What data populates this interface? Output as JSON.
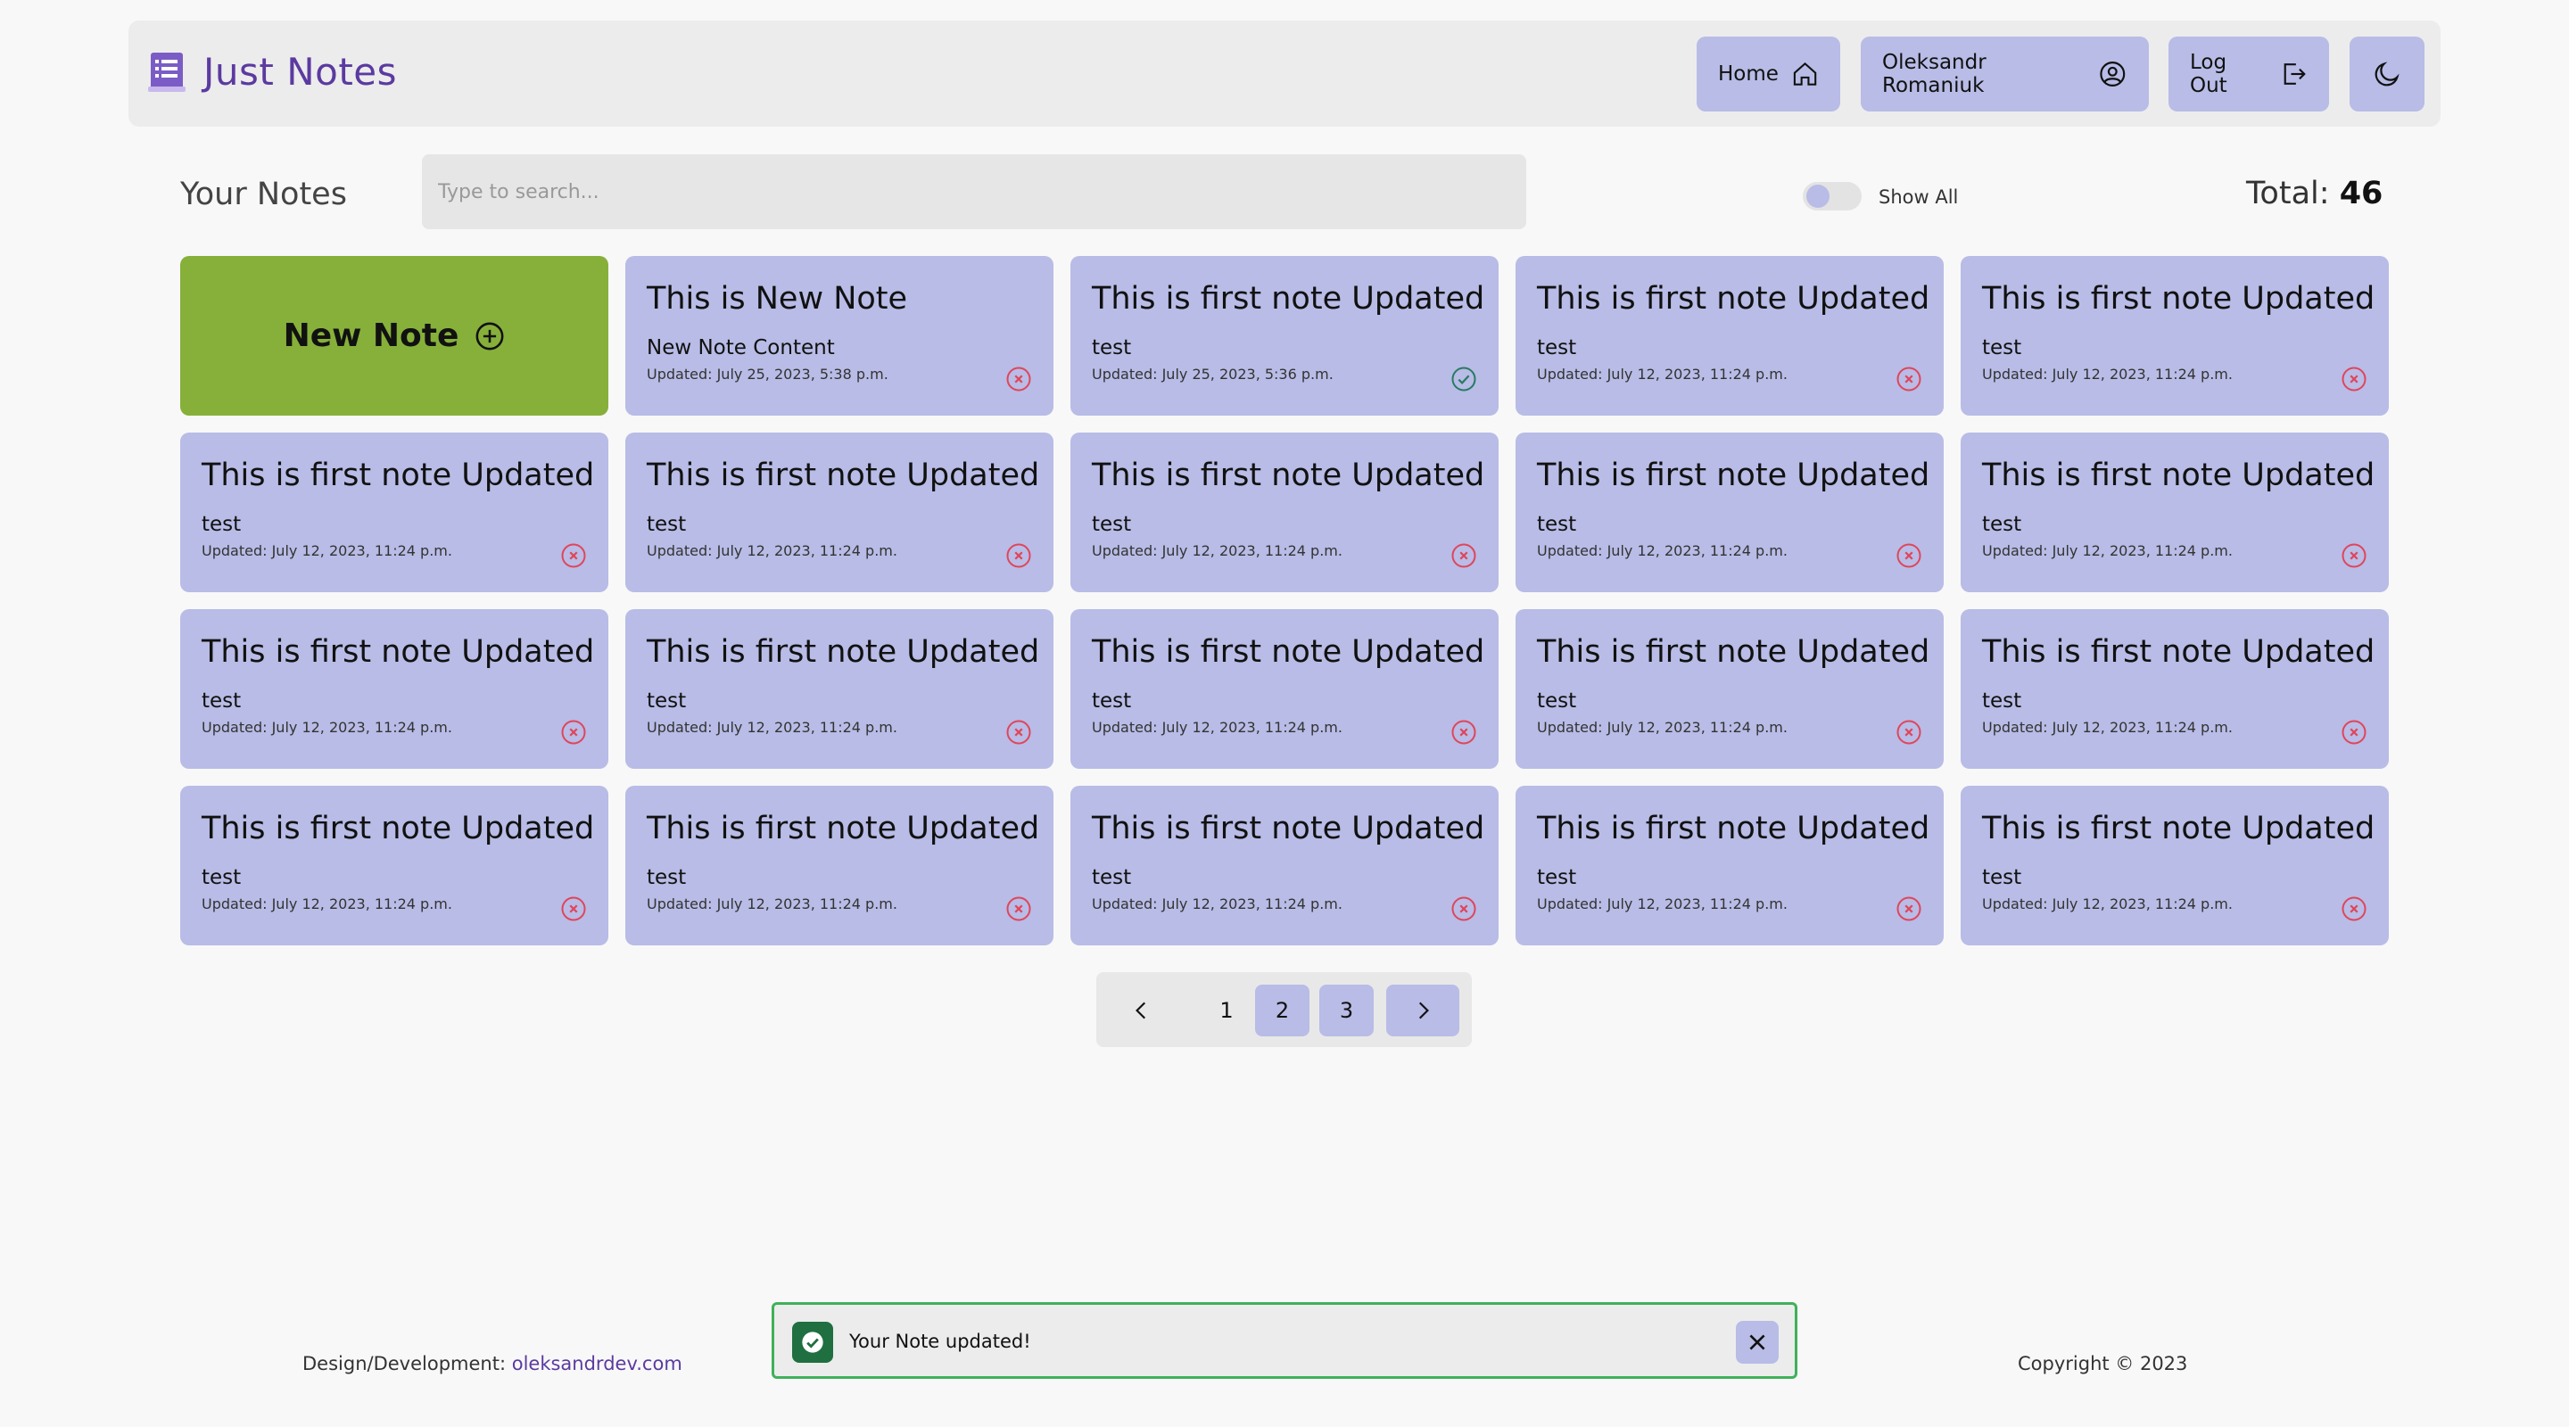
{
  "app": {
    "title": "Just Notes"
  },
  "nav": {
    "home_label": "Home",
    "user_label": "Oleksandr Romaniuk",
    "logout_label": "Log Out",
    "icons": [
      "notebook-icon",
      "home-icon",
      "user-circle-icon",
      "logout-icon",
      "moon-icon"
    ]
  },
  "toolbar": {
    "heading": "Your Notes",
    "search_placeholder": "Type to search...",
    "show_all_label": "Show All",
    "show_all_on": false,
    "total_label": "Total:",
    "total_value": "46"
  },
  "new_note": {
    "label": "New Note"
  },
  "notes": [
    {
      "title": "This is New Note",
      "content": "New Note Content",
      "date": "Updated: July 25, 2023, 5:38 p.m.",
      "done": false
    },
    {
      "title": "This is first note Updated",
      "content": "test",
      "date": "Updated: July 25, 2023, 5:36 p.m.",
      "done": true
    },
    {
      "title": "This is first note Updated",
      "content": "test",
      "date": "Updated: July 12, 2023, 11:24 p.m.",
      "done": false
    },
    {
      "title": "This is first note Updated",
      "content": "test",
      "date": "Updated: July 12, 2023, 11:24 p.m.",
      "done": false
    },
    {
      "title": "This is first note Updated",
      "content": "test",
      "date": "Updated: July 12, 2023, 11:24 p.m.",
      "done": false
    },
    {
      "title": "This is first note Updated",
      "content": "test",
      "date": "Updated: July 12, 2023, 11:24 p.m.",
      "done": false
    },
    {
      "title": "This is first note Updated",
      "content": "test",
      "date": "Updated: July 12, 2023, 11:24 p.m.",
      "done": false
    },
    {
      "title": "This is first note Updated",
      "content": "test",
      "date": "Updated: July 12, 2023, 11:24 p.m.",
      "done": false
    },
    {
      "title": "This is first note Updated",
      "content": "test",
      "date": "Updated: July 12, 2023, 11:24 p.m.",
      "done": false
    },
    {
      "title": "This is first note Updated",
      "content": "test",
      "date": "Updated: July 12, 2023, 11:24 p.m.",
      "done": false
    },
    {
      "title": "This is first note Updated",
      "content": "test",
      "date": "Updated: July 12, 2023, 11:24 p.m.",
      "done": false
    },
    {
      "title": "This is first note Updated",
      "content": "test",
      "date": "Updated: July 12, 2023, 11:24 p.m.",
      "done": false
    },
    {
      "title": "This is first note Updated",
      "content": "test",
      "date": "Updated: July 12, 2023, 11:24 p.m.",
      "done": false
    },
    {
      "title": "This is first note Updated",
      "content": "test",
      "date": "Updated: July 12, 2023, 11:24 p.m.",
      "done": false
    },
    {
      "title": "This is first note Updated",
      "content": "test",
      "date": "Updated: July 12, 2023, 11:24 p.m.",
      "done": false
    },
    {
      "title": "This is first note Updated",
      "content": "test",
      "date": "Updated: July 12, 2023, 11:24 p.m.",
      "done": false
    },
    {
      "title": "This is first note Updated",
      "content": "test",
      "date": "Updated: July 12, 2023, 11:24 p.m.",
      "done": false
    },
    {
      "title": "This is first note Updated",
      "content": "test",
      "date": "Updated: July 12, 2023, 11:24 p.m.",
      "done": false
    },
    {
      "title": "This is first note Updated",
      "content": "test",
      "date": "Updated: July 12, 2023, 11:24 p.m.",
      "done": false
    }
  ],
  "pagination": {
    "pages": [
      "1",
      "2",
      "3"
    ],
    "active": [
      "2",
      "3"
    ],
    "prev_icon": "chevron-left-icon",
    "next_icon": "chevron-right-icon"
  },
  "footer": {
    "credit_label": "Design/Development:",
    "credit_link": "oleksandrdev.com",
    "copyright": "Copyright © 2023"
  },
  "toast": {
    "message": "Your Note updated!"
  },
  "colors": {
    "brand": "#5b3aa0",
    "card": "#b8bce6",
    "new_note": "#86b03a",
    "success": "#1f6f40",
    "delete": "#e0455b",
    "done": "#2a7a62",
    "toast_border": "#3fb15a"
  }
}
